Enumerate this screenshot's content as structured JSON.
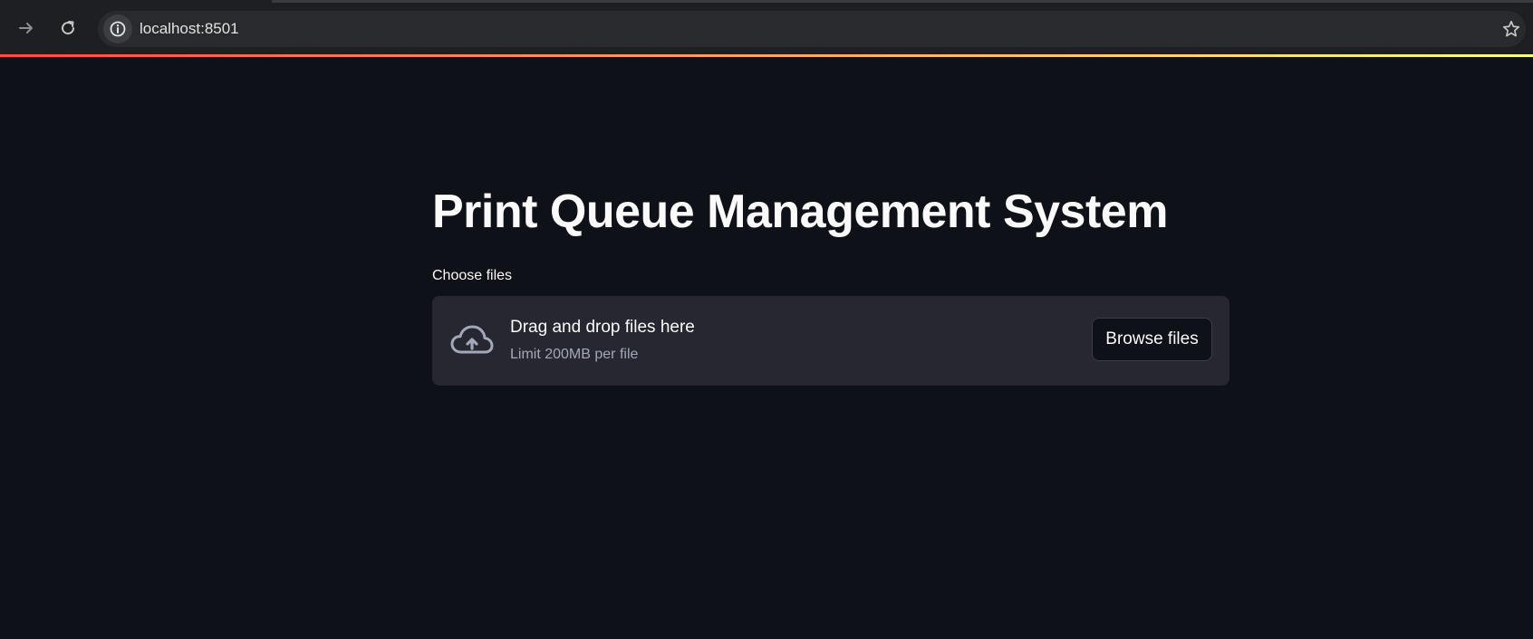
{
  "browser": {
    "url": "localhost:8501",
    "forward_icon": "arrow-right-icon",
    "reload_icon": "reload-icon",
    "site_info_icon": "info-icon",
    "bookmark_icon": "star-icon"
  },
  "theme": {
    "background": "#0e1117",
    "surface": "#262730",
    "text": "#fafafa",
    "muted": "#a3a8b8",
    "gradient_start": "#ff4b4b",
    "gradient_end": "#fffd80"
  },
  "page": {
    "title": "Print Queue Management System"
  },
  "uploader": {
    "label": "Choose files",
    "drop_text": "Drag and drop files here",
    "limit_text": "Limit 200MB per file",
    "browse_label": "Browse files",
    "icon": "cloud-upload-icon"
  }
}
